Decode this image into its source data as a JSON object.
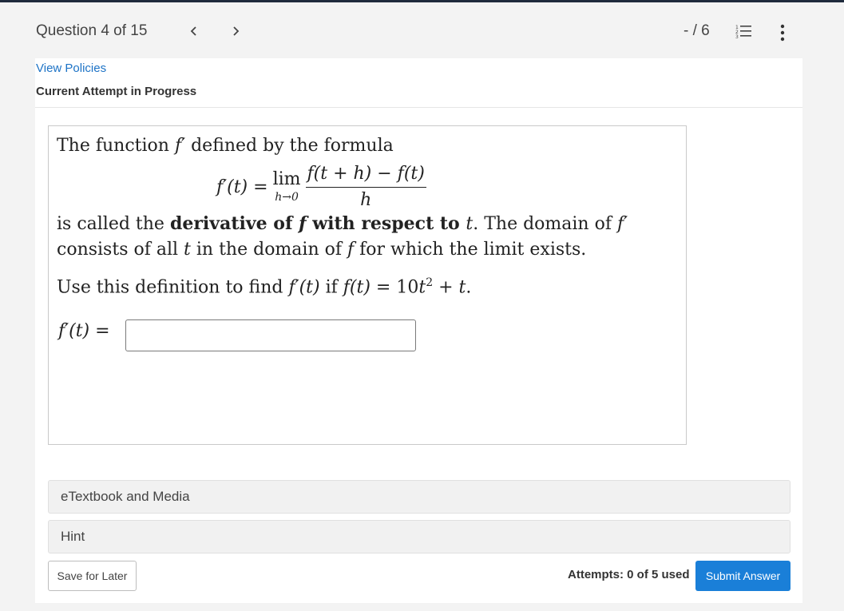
{
  "header": {
    "question_counter": "Question 4 of 15",
    "prev_icon": "chevron-left-icon",
    "next_icon": "chevron-right-icon",
    "score": "- / 6",
    "list_icon": "question-list-icon",
    "more_icon": "vertical-ellipsis-icon"
  },
  "assignment": {
    "view_policies": "View Policies",
    "status": "Current Attempt in Progress"
  },
  "question": {
    "line1": [
      "The function ",
      "f′",
      " defined by the formula"
    ],
    "formula": {
      "lhs": "f′(t) =",
      "lim": "lim",
      "lim_sub": "h→0",
      "numerator": "f(t + h) − f(t)",
      "denominator": "h"
    },
    "line2": [
      "is called the ",
      "derivative of ",
      "f",
      " with respect to ",
      "t",
      ". The domain of ",
      "f′"
    ],
    "line3": [
      "consists of all ",
      "t",
      " in the domain of ",
      "f",
      " for which the limit exists."
    ],
    "line4": [
      "Use this definition to find ",
      "f′(t)",
      " if ",
      "f(t)",
      " = 10",
      "t",
      "2",
      " + ",
      "t",
      "."
    ],
    "answer_label": "f′(t) =",
    "answer_value": ""
  },
  "sections": {
    "etextbook": "eTextbook and Media",
    "hint": "Hint"
  },
  "footer": {
    "save_later": "Save for Later",
    "attempts": "Attempts: 0 of 5 used",
    "submit": "Submit Answer"
  },
  "colors": {
    "link": "#1d73c6",
    "submit_bg": "#1a7fd8",
    "top_rule": "#1f2b3d"
  }
}
